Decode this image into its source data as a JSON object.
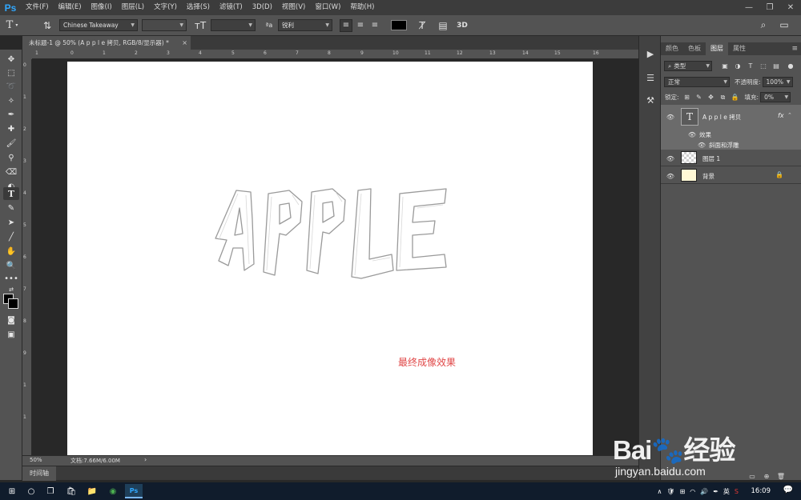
{
  "app": {
    "logo": "Ps",
    "menu": [
      "文件(F)",
      "编辑(E)",
      "图像(I)",
      "图层(L)",
      "文字(Y)",
      "选择(S)",
      "滤镜(T)",
      "3D(D)",
      "视图(V)",
      "窗口(W)",
      "帮助(H)"
    ],
    "window_controls": [
      "—",
      "❐",
      "✕"
    ]
  },
  "options_bar": {
    "tool_glyph": "T",
    "font_family": "Chinese Takeaway",
    "antialias": "锐利",
    "text_color": "#000000",
    "label_3d": "3D"
  },
  "document": {
    "tab_title": "未标题-1 @ 50% (A p p l e 拷贝, RGB/8/显示器) *",
    "close": "×",
    "art_text": "APPLE",
    "caption": "最终成像效果",
    "caption_color": "#e04848"
  },
  "rulers": {
    "top": [
      "1",
      "0",
      "1",
      "2",
      "3",
      "4",
      "5",
      "6",
      "7",
      "8",
      "9",
      "10",
      "11",
      "12",
      "13",
      "14",
      "15",
      "16"
    ],
    "left": [
      "0",
      "1",
      "2",
      "3",
      "4",
      "5",
      "6",
      "7",
      "8",
      "9",
      "1",
      "1"
    ]
  },
  "status": {
    "zoom": "50%",
    "doc_size": "文档:7.66M/6.00M",
    "arrow": "›"
  },
  "timeline": {
    "label": "时间轴"
  },
  "panels": {
    "tabs": [
      "颜色",
      "色板",
      "图层",
      "属性"
    ],
    "active_tab": "图层",
    "filter_kind": "类型",
    "blend_mode": "正常",
    "opacity_label": "不透明度:",
    "opacity_value": "100%",
    "lock_label": "锁定:",
    "fill_label": "填充:",
    "fill_value": "0%",
    "layers": [
      {
        "name": "A p p l e 拷贝",
        "type": "text",
        "fx": "fx"
      },
      {
        "name": "效果",
        "type": "effect-group"
      },
      {
        "name": "斜面和浮雕",
        "type": "effect"
      },
      {
        "name": "图层 1",
        "type": "pixel"
      },
      {
        "name": "背景",
        "type": "background"
      }
    ]
  },
  "watermark": {
    "brand": "Bai🐾经验",
    "url": "jingyan.baidu.com"
  },
  "taskbar": {
    "clock": "16:09",
    "ime": "英"
  }
}
